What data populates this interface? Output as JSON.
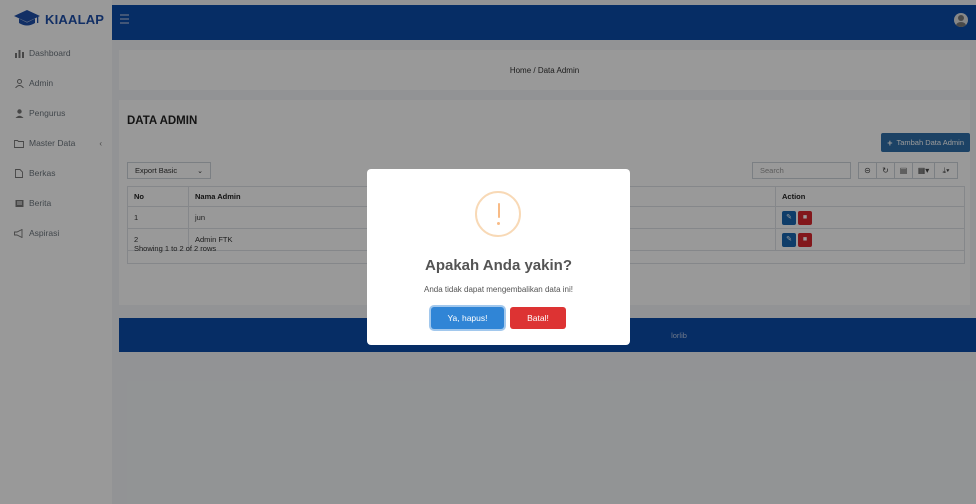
{
  "brand": {
    "name": "KIAALAP"
  },
  "sidebar": {
    "items": [
      {
        "label": "Dashboard",
        "icon": "bar-chart-icon"
      },
      {
        "label": "Admin",
        "icon": "user-icon"
      },
      {
        "label": "Pengurus",
        "icon": "user-tie-icon"
      },
      {
        "label": "Master Data",
        "icon": "folder-icon"
      },
      {
        "label": "Berkas",
        "icon": "file-icon"
      },
      {
        "label": "Berita",
        "icon": "newspaper-icon"
      },
      {
        "label": "Aspirasi",
        "icon": "bullhorn-icon"
      }
    ]
  },
  "breadcrumb": "Home / Data Admin",
  "page": {
    "title": "DATA ADMIN",
    "add_button": "Tambah Data Admin",
    "export_select": "Export Basic",
    "search_placeholder": "Search"
  },
  "table": {
    "headers": [
      "No",
      "Nama Admin",
      "Action"
    ],
    "rows": [
      {
        "no": "1",
        "name": "jun"
      },
      {
        "no": "2",
        "name": "Admin FTK"
      }
    ],
    "pagination": "Showing 1 to 2 of 2 rows"
  },
  "footer": {
    "text": "lorlib"
  },
  "modal": {
    "title": "Apakah Anda yakin?",
    "text": "Anda tidak dapat mengembalikan data ini!",
    "confirm": "Ya, hapus!",
    "cancel": "Batal!"
  },
  "colors": {
    "primary": "#0b4ba8",
    "confirm": "#3085d6",
    "cancel": "#dd3333",
    "warning": "#f8bb86"
  }
}
